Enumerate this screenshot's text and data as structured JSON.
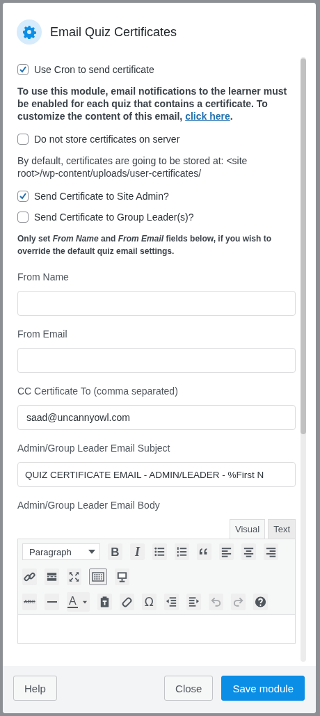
{
  "dialog": {
    "title": "Email Quiz Certificates"
  },
  "options": [
    {
      "kind": "checkbox",
      "label": "Use Cron to send certificate",
      "checked": true
    },
    {
      "kind": "note",
      "text": "To use this module, email notifications to the learner must be enabled for each quiz that contains a certificate. To customize the content of this email, ",
      "link": "click here",
      "after": "."
    },
    {
      "kind": "checkbox",
      "label": "Do not store certificates on server",
      "checked": false
    },
    {
      "kind": "text",
      "text": "By default, certificates are going to be stored at: <site root>/wp-content/uploads/user-certificates/"
    },
    {
      "kind": "checkbox",
      "label": "Send Certificate to Site Admin?",
      "checked": true
    },
    {
      "kind": "checkbox",
      "label": "Send Certificate to Group Leader(s)?",
      "checked": false
    },
    {
      "kind": "small",
      "text": "Only set *From Name* and *From Email* fields below, if you wish to override the default quiz email settings."
    }
  ],
  "fields": [
    {
      "label": "From Name"
    },
    {
      "label": "From Email"
    },
    {
      "label": "CC Certificate To (comma separated)",
      "value": "saad@uncannyowl.com"
    },
    {
      "label": "Admin/Group Leader Email Subject",
      "value": "QUIZ CERTIFICATE EMAIL - ADMIN/LEADER - %First N"
    }
  ],
  "editor": {
    "label": "Admin/Group Leader Email Body",
    "tabs": [
      {
        "label": "Visual",
        "selected": true
      },
      {
        "label": "Text",
        "selected": false
      }
    ],
    "format": "Paragraph",
    "toolbar": [
      [
        {
          "kind": "bold",
          "label": "B"
        },
        {
          "kind": "italic",
          "label": "I"
        },
        {
          "kind": "bullets"
        },
        {
          "kind": "numbers"
        },
        {
          "kind": "quote"
        },
        {
          "kind": "align-left"
        },
        {
          "kind": "align-center"
        },
        {
          "kind": "align-right"
        }
      ],
      [
        {
          "kind": "link",
          "pressed": false
        },
        {
          "kind": "more",
          "pressed": false
        },
        {
          "kind": "fullscreen",
          "pressed": false
        },
        {
          "kind": "toolbar-toggle",
          "pressed": true
        },
        {
          "kind": "monitor",
          "pressed": false
        }
      ],
      [
        {
          "kind": "strike",
          "label": "ABC"
        },
        {
          "kind": "hr"
        },
        {
          "kind": "color",
          "label": "A"
        },
        {
          "kind": "paste"
        },
        {
          "kind": "eraser"
        },
        {
          "kind": "char",
          "label": "Ω"
        },
        {
          "kind": "outdent"
        },
        {
          "kind": "indent"
        },
        {
          "kind": "undo",
          "disabled": true
        },
        {
          "kind": "redo",
          "disabled": true
        },
        {
          "kind": "help"
        }
      ]
    ]
  },
  "footer": {
    "buttons": [
      {
        "label": "Help",
        "kind": "secondary"
      },
      {
        "label": "Close",
        "kind": "secondary"
      },
      {
        "label": "Save module",
        "kind": "primary"
      }
    ]
  }
}
